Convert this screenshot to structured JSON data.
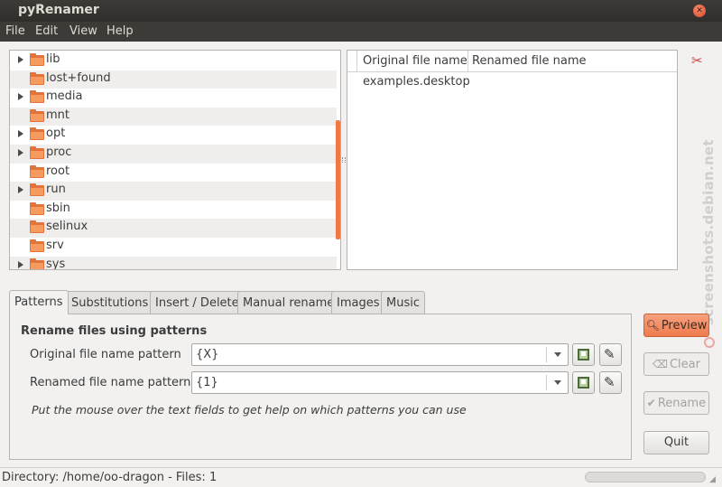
{
  "window": {
    "title": "pyRenamer"
  },
  "menu": [
    "File",
    "Edit",
    "View",
    "Help"
  ],
  "tree": {
    "items": [
      {
        "label": "lib",
        "expandable": true
      },
      {
        "label": "lost+found",
        "expandable": false
      },
      {
        "label": "media",
        "expandable": true
      },
      {
        "label": "mnt",
        "expandable": false
      },
      {
        "label": "opt",
        "expandable": true
      },
      {
        "label": "proc",
        "expandable": true
      },
      {
        "label": "root",
        "expandable": false
      },
      {
        "label": "run",
        "expandable": true
      },
      {
        "label": "sbin",
        "expandable": false
      },
      {
        "label": "selinux",
        "expandable": false
      },
      {
        "label": "srv",
        "expandable": false
      },
      {
        "label": "sys",
        "expandable": true
      }
    ]
  },
  "filelist": {
    "columns": [
      "Original file name",
      "Renamed file name"
    ],
    "rows": [
      {
        "original": "examples.desktop",
        "renamed": ""
      }
    ]
  },
  "tabs": [
    "Patterns",
    "Substitutions",
    "Insert / Delete",
    "Manual rename",
    "Images",
    "Music"
  ],
  "active_tab": "Patterns",
  "patterns": {
    "section_title": "Rename files using patterns",
    "original_label": "Original file name pattern",
    "original_value": "{X}",
    "renamed_label": "Renamed file name pattern",
    "renamed_value": "{1}",
    "hint": "Put the mouse over the text fields to get help on which patterns you can use"
  },
  "buttons": {
    "preview": "Preview",
    "clear": "Clear",
    "rename": "Rename",
    "quit": "Quit"
  },
  "status": {
    "text": "Directory: /home/oo-dragon - Files: 1"
  },
  "watermark": "screenshots.debian.net",
  "colors": {
    "accent": "#ef7b4e",
    "folder": "#e2733a",
    "titlebar": "#3c3b37"
  },
  "icons": {
    "tools": "tools-icon",
    "save": "save-pattern-icon",
    "edit": "edit-pattern-icon"
  }
}
